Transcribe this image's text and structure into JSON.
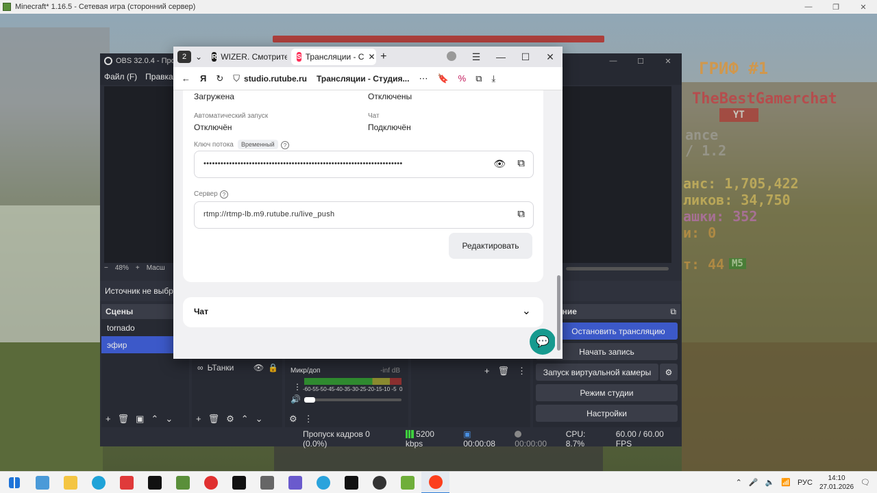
{
  "minecraft": {
    "window_title": "Minecraft* 1.16.5 - Сетевая игра (сторонний сервер)",
    "hud_lines": [
      "ГРИФ #1",
      "TheBestGamerchat",
      "YT",
      "ance",
      "/ 1.2",
      "анс: 1,705,422",
      "ликов: 34,750",
      "ашки: 352",
      "и: 0",
      "т: 44"
    ],
    "hud_badges": [
      "M5"
    ]
  },
  "obs": {
    "title": "OBS 32.0.4 - Профи",
    "menu": [
      "Файл (F)",
      "Правка ("
    ],
    "zoom": {
      "minus": "−",
      "percent": "48%",
      "plus": "+",
      "scale_label": "Масш"
    },
    "source_status": "Источник не выбра",
    "scenes": {
      "header": "Сцены",
      "items": [
        "tornado",
        "эфир"
      ],
      "active_index": 1
    },
    "sources": {
      "item": "ЬТанки"
    },
    "mixer": {
      "name": "Микр/доп",
      "level": "-inf dB",
      "scale": "-60-55-50-45-40-35-30-25-20-15-10 -5  0"
    },
    "controls": {
      "header": "ение",
      "stop_stream": "Остановить трансляцию",
      "start_record": "Начать запись",
      "virtual_cam": "Запуск виртуальной камеры",
      "studio_mode": "Режим студии",
      "settings": "Настройки"
    },
    "status": {
      "dropped": "Пропуск кадров 0 (0.0%)",
      "bitrate": "5200 kbps",
      "live_time": "00:00:08",
      "rec_time": "00:00:00",
      "cpu": "CPU: 8.7%",
      "fps": "60.00 / 60.00 FPS"
    }
  },
  "browser": {
    "tab_count": "2",
    "tabs": [
      {
        "label": "WIZER. Смотрите",
        "favicon": "R"
      },
      {
        "label": "Трансляции - С",
        "favicon": "S"
      }
    ],
    "active_tab_index": 1,
    "address": {
      "url": "studio.rutube.ru",
      "page_title": "Трансляции - Студия..."
    },
    "stream_info": {
      "top_left_value": "Загружена",
      "top_right_value": "Отключены",
      "auto_start_label": "Автоматический запуск",
      "auto_start_value": "Отключён",
      "chat_label": "Чат",
      "chat_value": "Подключён",
      "key_label": "Ключ потока",
      "key_badge": "Временный",
      "key_value": "••••••••••••••••••••••••••••••••••••••••••••••••••••••••••••••••••••••",
      "server_label": "Сервер",
      "server_value": "rtmp://rtmp-lb.m9.rutube.ru/live_push",
      "edit_button": "Редактировать"
    },
    "chat_section": {
      "label": "Чат"
    }
  },
  "taskbar": {
    "apps": [
      "start",
      "explorer-window",
      "file-explorer",
      "edge",
      "presentation",
      "capcut",
      "minecraft",
      "opera",
      "terminal",
      "tanks",
      "image-viewer",
      "telegram",
      "rutube",
      "obs",
      "minecraft-launcher",
      "yandex-browser"
    ],
    "active_app": "yandex-browser",
    "language": "РУС",
    "time": "14:10",
    "date": "27.01.2026"
  },
  "colors": {
    "obs_bg": "#2b2e38",
    "obs_accent": "#3c59c9",
    "rutube_accent": "#179a8f",
    "hud_bar": "#b3261e"
  }
}
